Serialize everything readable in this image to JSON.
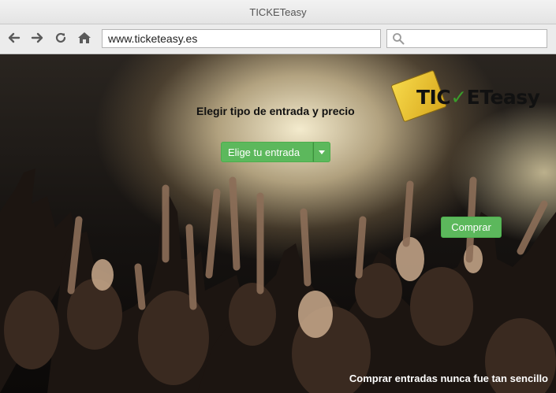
{
  "window": {
    "title": "TICKETeasy"
  },
  "toolbar": {
    "url": "www.ticketeasy.es",
    "search_placeholder": "",
    "back_icon": "back-arrow-icon",
    "forward_icon": "forward-arrow-icon",
    "reload_icon": "reload-icon",
    "home_icon": "home-icon"
  },
  "page": {
    "heading": "Elegir tipo de entrada y precio",
    "logo": {
      "prefix": "TIC",
      "suffix": "ETeasy"
    },
    "ticket_select": {
      "selected": "Elige tu entrada"
    },
    "buy_button": "Comprar",
    "tagline": "Comprar entradas nunca fue tan sencillo"
  },
  "colors": {
    "accent_green": "#5cb85c",
    "logo_yellow": "#f2cf3e",
    "check_green": "#3a9b2b"
  }
}
